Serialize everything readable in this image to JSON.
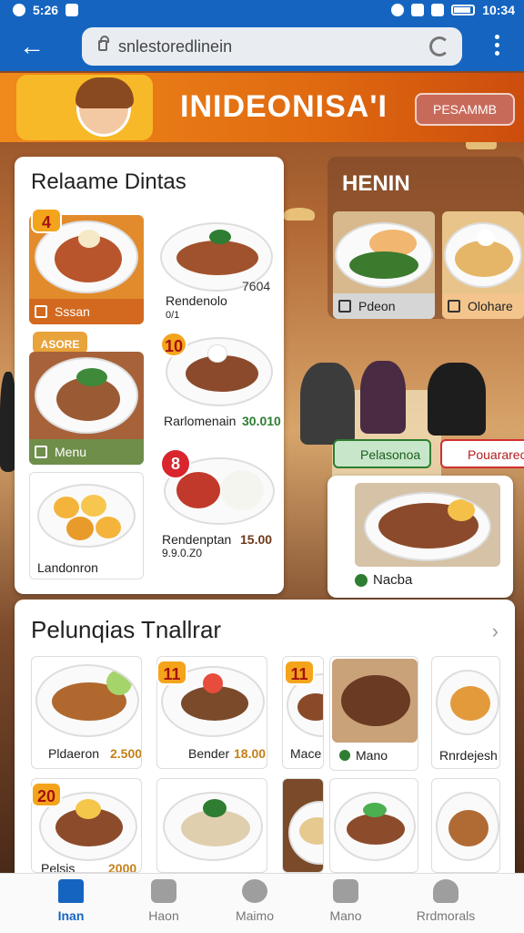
{
  "status_bar": {
    "time_left": "5:26",
    "time_right": "10:34"
  },
  "browser": {
    "url": "snlestoredlinein"
  },
  "banner": {
    "title": "INIDEONISA'I",
    "button": "PESAMMB"
  },
  "card_left": {
    "title": "Relaame Dintas",
    "tiles": [
      {
        "badge": "4",
        "label": "Sssan"
      },
      {
        "badge": "ASORE",
        "label": "Menu"
      },
      {
        "badge": "",
        "label": "Landonron"
      }
    ],
    "items": [
      {
        "name": "Rendenolo",
        "sub": "0/1",
        "price": "7604"
      },
      {
        "badge": "10",
        "name": "Rarlomenain",
        "price": "30.010"
      },
      {
        "badge": "8",
        "name": "Rendenptan",
        "sub": "9.9.0.Z0",
        "price": "15.00"
      }
    ]
  },
  "card_menu": {
    "title": "HENIN",
    "tiles": [
      {
        "label": "Pdeon"
      },
      {
        "label": "Olohare"
      }
    ]
  },
  "chips": {
    "left": "Pelasonoa",
    "right": "Pouarareo"
  },
  "card_right": {
    "label": "Nacba"
  },
  "card_bottom": {
    "title": "Pelunqias Tnallrar",
    "items": [
      {
        "name": "Pldaeron",
        "price": "2.500"
      },
      {
        "badge": "11",
        "name": "Bender",
        "price": "18.00"
      },
      {
        "badge": "11",
        "name": "Mace"
      },
      {
        "name": "Mano"
      },
      {
        "name": "Rnrdejesh"
      },
      {
        "badge": "20",
        "name": "Pelsis",
        "price": "2000"
      }
    ]
  },
  "bottom_nav": [
    {
      "label": "Inan",
      "icon": "home-icon",
      "active": true
    },
    {
      "label": "Haon",
      "icon": "bag-icon"
    },
    {
      "label": "Maimo",
      "icon": "plate-icon"
    },
    {
      "label": "Mano",
      "icon": "menu-icon"
    },
    {
      "label": "Rrdmorals",
      "icon": "profile-icon"
    }
  ],
  "colors": {
    "primary": "#1565c0",
    "accent": "#f08a1c",
    "green": "#2e7d32"
  }
}
